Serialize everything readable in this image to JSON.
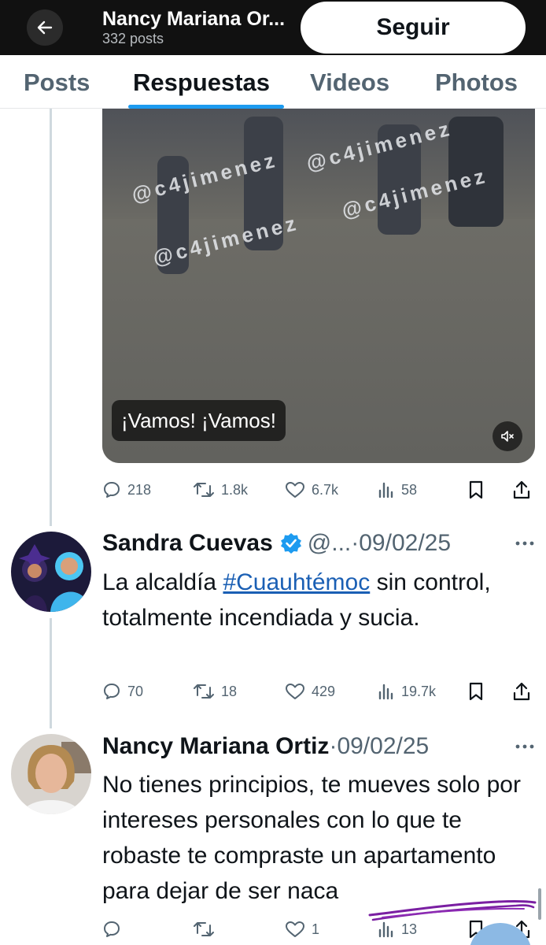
{
  "header": {
    "profile_name": "Nancy Mariana Or...",
    "post_count": "332 posts",
    "follow_label": "Seguir"
  },
  "tabs": [
    {
      "label": "Posts"
    },
    {
      "label": "Respuestas"
    },
    {
      "label": "Videos"
    },
    {
      "label": "Photos"
    }
  ],
  "video": {
    "watermark": "@c4jimenez",
    "caption": "¡Vamos! ¡Vamos!"
  },
  "post1_stats": {
    "replies": "218",
    "reposts": "1.8k",
    "likes": "6.7k",
    "views": "58"
  },
  "tweet2": {
    "name": "Sandra Cuevas",
    "handle": "@...",
    "separator": "·",
    "date": "09/02/25",
    "text_before": "La alcaldía ",
    "hashtag": "#Cuauhtémoc",
    "text_after": " sin control, totalmente incendiada y sucia.",
    "stats": {
      "replies": "70",
      "reposts": "18",
      "likes": "429",
      "views": "19.7k"
    }
  },
  "tweet3": {
    "name": "Nancy Mariana Ortiz",
    "separator": "·",
    "date": "09/02/25",
    "text": "No tienes principios, te mueves solo por intereses personales con lo que te robaste te compraste un apartamento para dejar de ser naca",
    "stats": {
      "replies": "",
      "reposts": "",
      "likes": "1",
      "views": "13"
    }
  },
  "colors": {
    "accent": "#1d9bf0",
    "hashtag": "#1a5fb4",
    "muted": "#536471",
    "annotation": "#7a1fa2"
  }
}
